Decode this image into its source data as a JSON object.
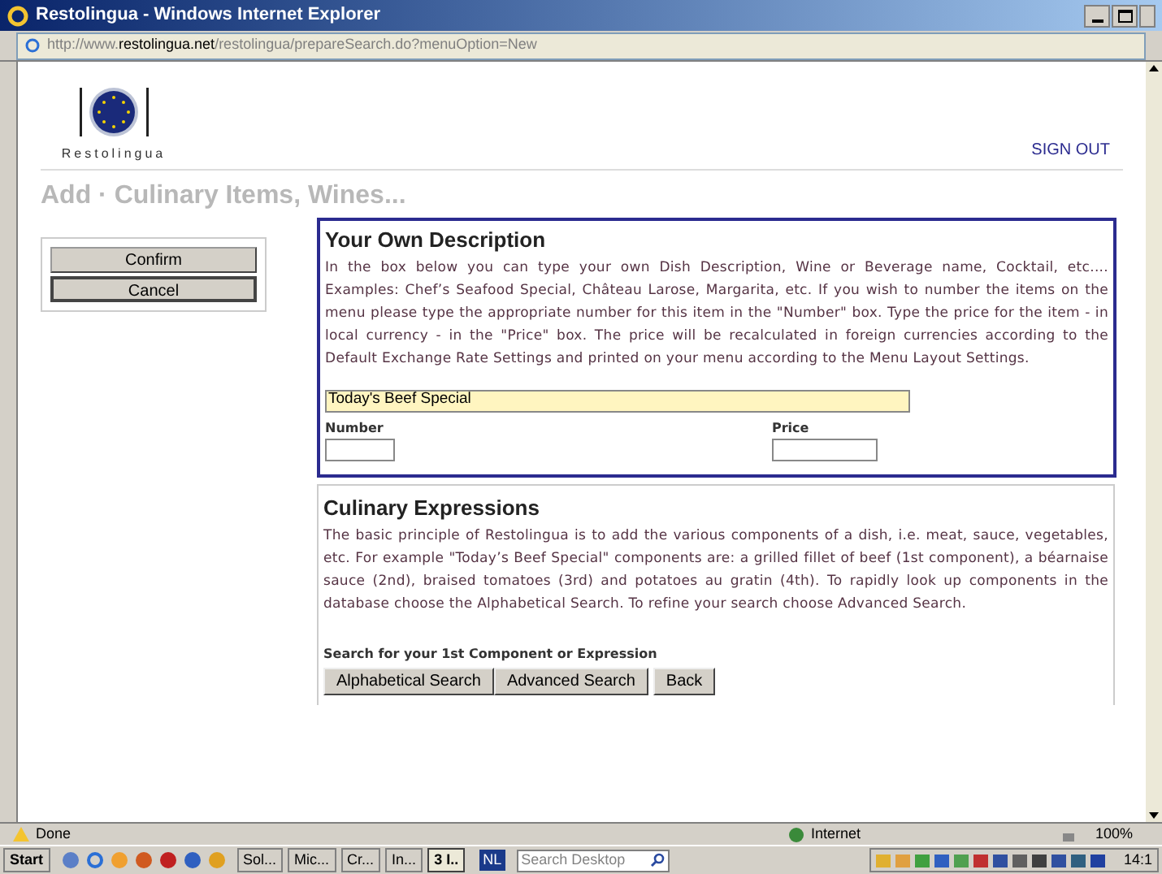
{
  "window": {
    "title": "Restolingua - Windows Internet Explorer"
  },
  "address": {
    "prefix": "http://www.",
    "domain": "restolingua.net",
    "path": "/restolingua/prepareSearch.do?menuOption=New"
  },
  "header": {
    "logo_text": "Restolingua",
    "sign_out": "SIGN OUT"
  },
  "page_title": "Add · Culinary Items, Wines...",
  "side_buttons": [
    "Confirm",
    "Cancel"
  ],
  "description": {
    "heading": "Your Own Description",
    "text": "In the box below you can type your own Dish Description, Wine or Beverage name, Cocktail, etc.... Examples: Chef’s Seafood Special, Château Larose, Margarita, etc. If you wish to number the items on the menu please type the appropriate number for this item in the \"Number\" box. Type the price for the item - in local currency - in the \"Price\" box. The price will be recalculated in foreign currencies according to the Default Exchange Rate Settings and printed on your menu according to the Menu Layout Settings.",
    "name_value": "Today's Beef Special",
    "number_label": "Number",
    "price_label": "Price"
  },
  "expressions": {
    "heading": "Culinary Expressions",
    "text": "The basic principle of Restolingua is to add the various components of a dish, i.e. meat, sauce, vegetables, etc. For example \"Today’s Beef Special\" components are: a grilled fillet of beef (1st component), a béarnaise sauce (2nd), braised tomatoes (3rd) and potatoes au gratin (4th). To rapidly look up components in the database choose the Alphabetical Search. To refine your search choose Advanced Search.",
    "search_label": "Search for your 1st Component or Expression",
    "buttons": [
      "Alphabetical Search",
      "Advanced Search",
      "Back"
    ]
  },
  "status_bar": {
    "status": "Done",
    "zone": "Internet",
    "zoom": "100%"
  },
  "taskbar": {
    "start": "Start",
    "tasks": [
      {
        "label": "Sol...",
        "selected": false
      },
      {
        "label": "Mic...",
        "selected": false
      },
      {
        "label": "Cr...",
        "selected": false
      },
      {
        "label": "In...",
        "selected": false
      },
      {
        "label": "3 I..",
        "selected": true
      }
    ],
    "language": "NL",
    "search_placeholder": "Search Desktop",
    "clock": "14:1"
  }
}
